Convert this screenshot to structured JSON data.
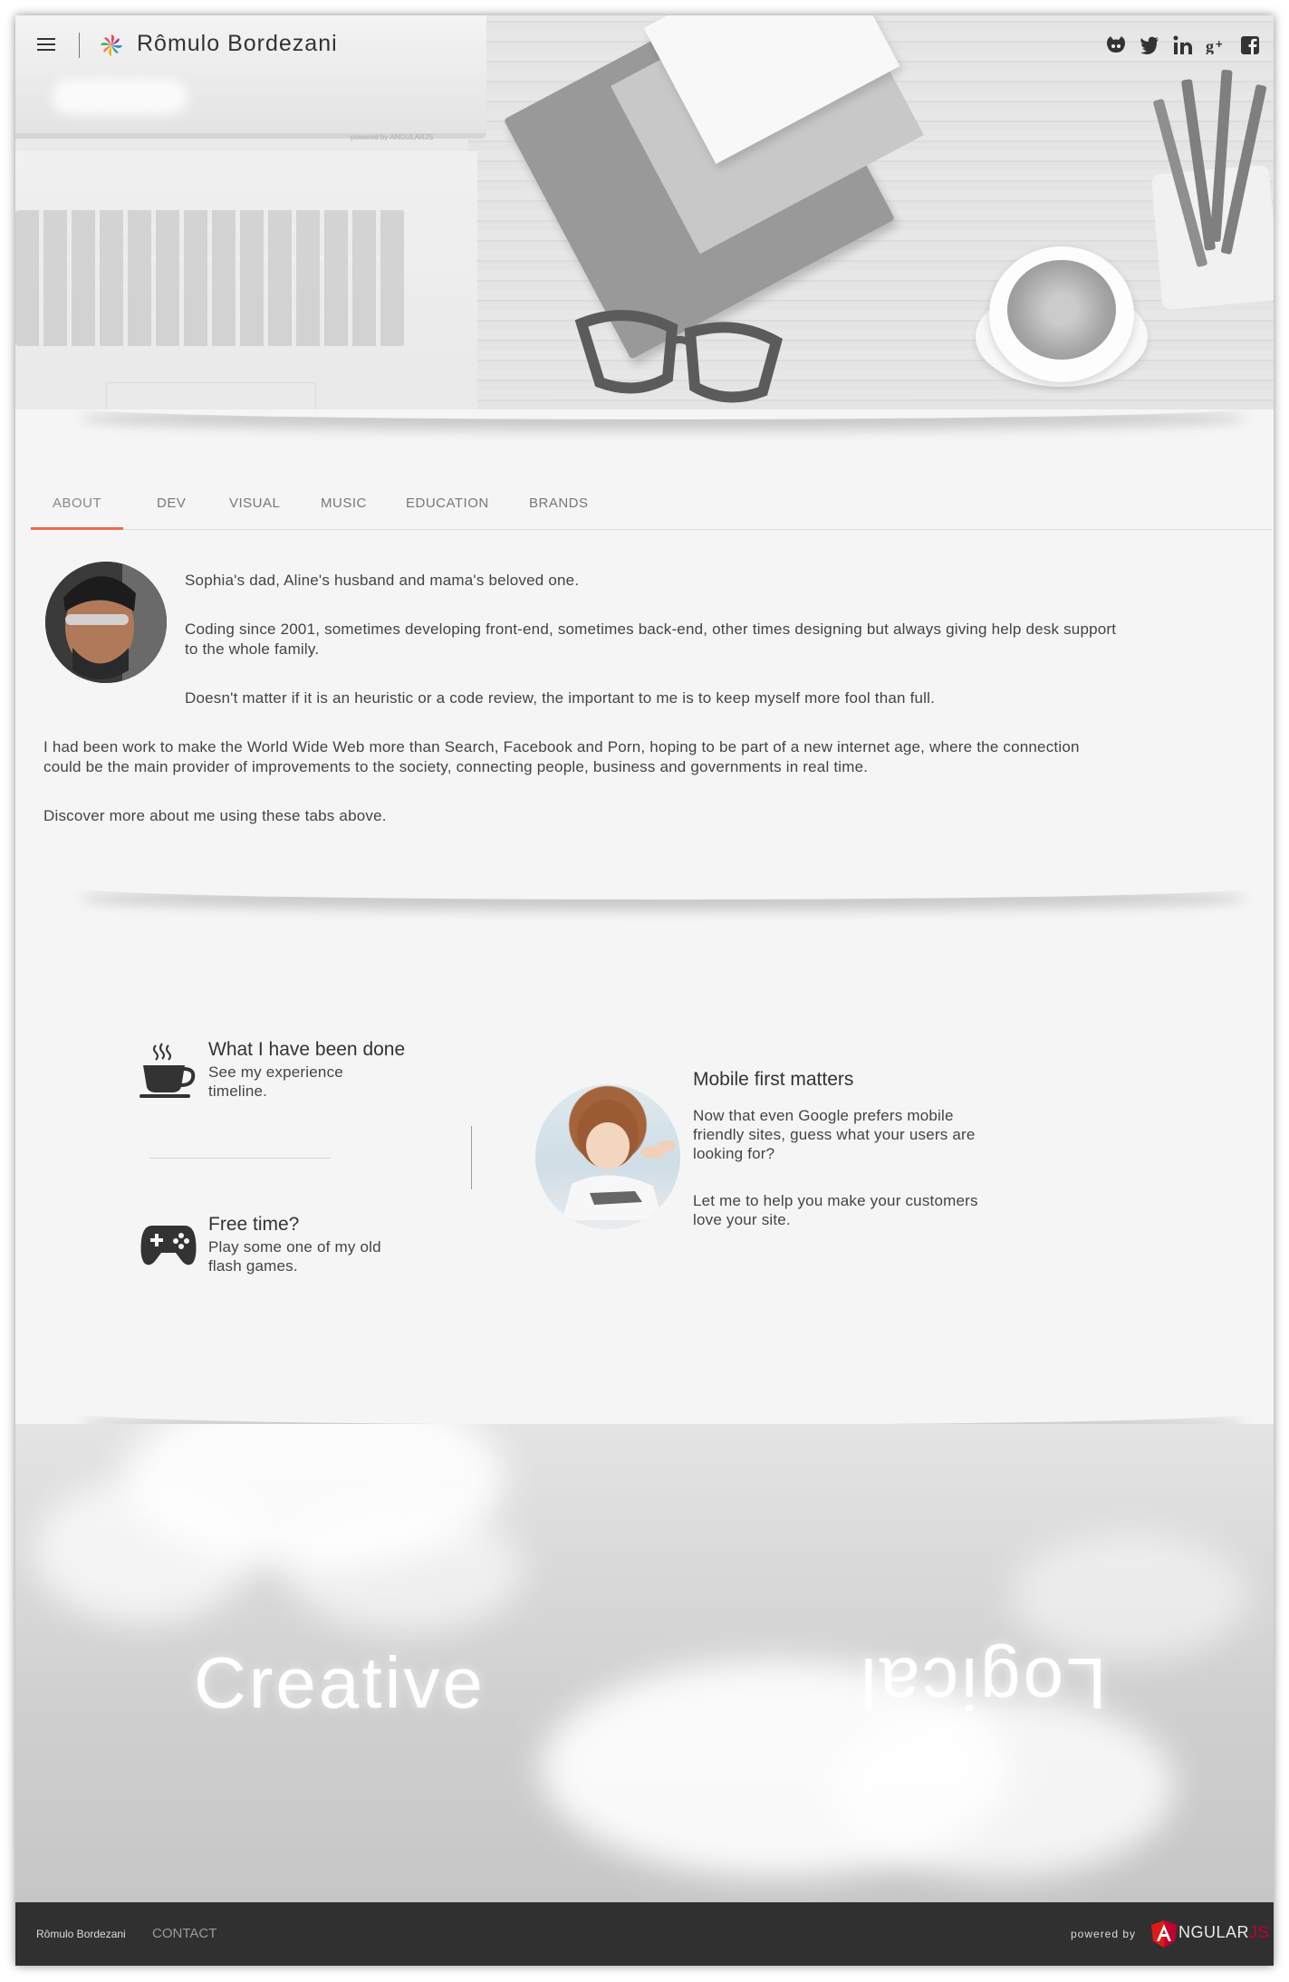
{
  "header": {
    "title": "Rômulo Bordezani",
    "menu_icon": "hamburger-menu-icon",
    "social": [
      "github-icon",
      "twitter-icon",
      "linkedin-icon",
      "google-plus-icon",
      "facebook-icon"
    ]
  },
  "hero": {
    "laptop_badge": "powered by ANGULARJS"
  },
  "tabs": [
    {
      "label": "ABOUT",
      "active": true
    },
    {
      "label": "DEV"
    },
    {
      "label": "VISUAL"
    },
    {
      "label": "MUSIC"
    },
    {
      "label": "EDUCATION"
    },
    {
      "label": "BRANDS"
    }
  ],
  "about": {
    "p1": "Sophia's dad, Aline's husband and mama's beloved one.",
    "p2a": "Coding since 2001, sometimes developing front-end, sometimes back-end, other times designing but always giving help desk support",
    "p2b": "to the whole family.",
    "p3": "Doesn't matter if it is an heuristic or a code review, the important to me is to keep myself more fool than full.",
    "p4a": "I had been work to make the World Wide Web more than Search, Facebook and Porn, hoping to be part of a new internet age, where the connection",
    "p4b": "could be the main provider of improvements to the society, connecting people, business and governments in real time.",
    "p5": "Discover more about me using these tabs above."
  },
  "features": {
    "experience": {
      "title": "What I have been done",
      "line1": "See my experience",
      "line2": "timeline.",
      "icon": "coffee-cup-icon"
    },
    "free_time": {
      "title": "Free time?",
      "line1": "Play some one of my old",
      "line2": "flash games.",
      "icon": "gamepad-icon"
    },
    "mobile": {
      "title": "Mobile first matters",
      "l1": "Now that even Google prefers mobile",
      "l2": "friendly sites, guess what your users are",
      "l3": "looking for?",
      "l4": "Let me to help you make your customers",
      "l5": "love your site."
    }
  },
  "banner": {
    "left_word": "Creative",
    "right_word": "Logical"
  },
  "footer": {
    "name": "Rômulo Bordezani",
    "contact": "CONTACT",
    "powered": "powered by",
    "angular_main": "NGULAR",
    "angular_js": "JS"
  },
  "colors": {
    "accent": "#ef6c4a",
    "footer_bg": "#303030",
    "angular_red": "#c3002f"
  }
}
